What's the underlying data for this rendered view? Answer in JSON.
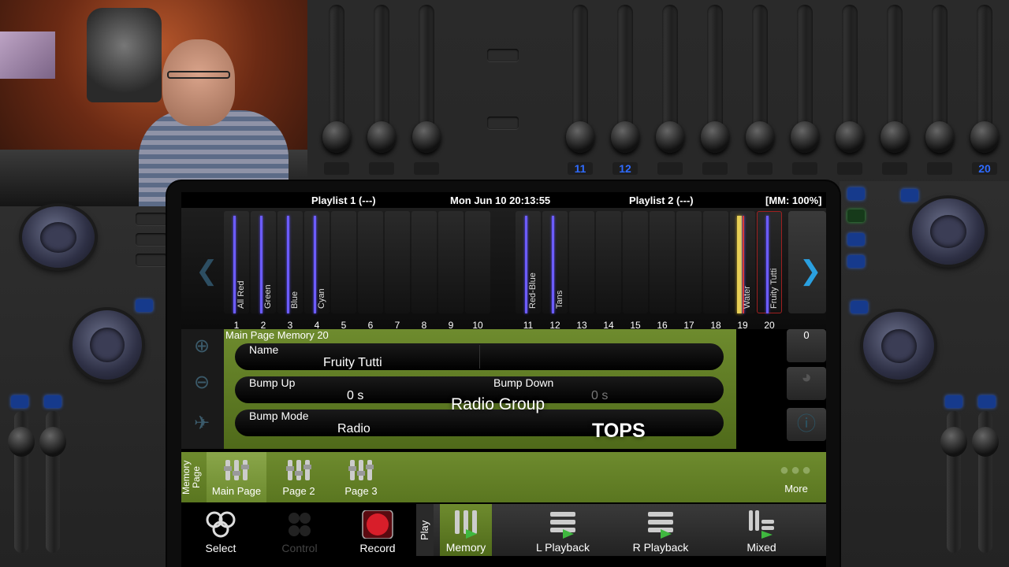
{
  "status": {
    "playlist1": "Playlist 1 (---)",
    "datetime": "Mon Jun 10 20:13:55",
    "playlist2": "Playlist 2 (---)",
    "mm": "[MM: 100%]"
  },
  "top_faders": [
    "11",
    "12",
    "20"
  ],
  "channels": [
    {
      "num": "1",
      "label": "All Red",
      "level": 0.95
    },
    {
      "num": "2",
      "label": "Green",
      "level": 0.95
    },
    {
      "num": "3",
      "label": "Blue",
      "level": 0.95
    },
    {
      "num": "4",
      "label": "Cyan",
      "level": 0.95
    },
    {
      "num": "5",
      "label": "",
      "level": 0
    },
    {
      "num": "6",
      "label": "",
      "level": 0
    },
    {
      "num": "7",
      "label": "",
      "level": 0
    },
    {
      "num": "8",
      "label": "",
      "level": 0
    },
    {
      "num": "9",
      "label": "",
      "level": 0
    },
    {
      "num": "10",
      "label": "",
      "level": 0
    },
    {
      "num": "11",
      "label": "Red-Blue",
      "level": 0.95
    },
    {
      "num": "12",
      "label": "Tans",
      "level": 0.95
    },
    {
      "num": "13",
      "label": "",
      "level": 0
    },
    {
      "num": "14",
      "label": "",
      "level": 0
    },
    {
      "num": "15",
      "label": "",
      "level": 0
    },
    {
      "num": "16",
      "label": "",
      "level": 0
    },
    {
      "num": "17",
      "label": "",
      "level": 0
    },
    {
      "num": "18",
      "label": "",
      "level": 0
    },
    {
      "num": "19",
      "label": "Water",
      "level": 0.95
    },
    {
      "num": "20",
      "label": "Fruity Tutti",
      "level": 0.95
    }
  ],
  "memory": {
    "title": "Main Page Memory 20",
    "name_label": "Name",
    "name_value": "Fruity Tutti",
    "bump_up_label": "Bump Up",
    "bump_up_value": "0 s",
    "bump_down_label": "Bump Down",
    "bump_down_value": "0 s",
    "bump_mode_label": "Bump Mode",
    "bump_mode_value": "Radio",
    "overlay_group": "Radio Group",
    "overlay_tops": "TOPS"
  },
  "right_value": "0",
  "memory_page_label": "Memory Page",
  "pages": [
    {
      "label": "Main Page",
      "active": true
    },
    {
      "label": "Page 2",
      "active": false
    },
    {
      "label": "Page 3",
      "active": false
    }
  ],
  "more_label": "More",
  "toolbar": {
    "select": "Select",
    "control": "Control",
    "record": "Record",
    "play": "Play",
    "memory": "Memory",
    "l_playback": "L Playback",
    "r_playback": "R Playback",
    "mixed": "Mixed"
  },
  "colors": {
    "accent_green": "#6e8b2e",
    "channel_bar": "#6c5cff",
    "water_bar": "#e8cf55",
    "record_red": "#d81e2a",
    "nav_blue": "#2aa0e0"
  }
}
